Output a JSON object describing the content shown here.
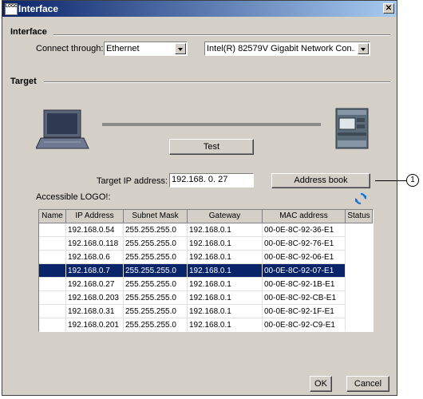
{
  "window": {
    "title": "Interface",
    "icon_text": "LOGO",
    "close_label": "✕"
  },
  "interface_section": {
    "label": "Interface",
    "connect_label": "Connect through:",
    "connect_value": "Ethernet",
    "adapter_value": "Intel(R) 82579V Gigabit Network Con..."
  },
  "target_section": {
    "label": "Target",
    "test_button": "Test",
    "target_ip_label": "Target IP address:",
    "target_ip_value": "192.168.  0. 27",
    "address_book_button": "Address book",
    "accessible_label": "Accessible LOGO!:"
  },
  "table": {
    "columns": [
      "Name",
      "IP Address",
      "Subnet Mask",
      "Gateway",
      "MAC address",
      "Status"
    ],
    "rows": [
      [
        "",
        "192.168.0.54",
        "255.255.255.0",
        "192.168.0.1",
        "00-0E-8C-92-36-E1",
        ""
      ],
      [
        "",
        "192.168.0.118",
        "255.255.255.0",
        "192.168.0.1",
        "00-0E-8C-92-76-E1",
        ""
      ],
      [
        "",
        "192.168.0.6",
        "255.255.255.0",
        "192.168.0.1",
        "00-0E-8C-92-06-E1",
        ""
      ],
      [
        "",
        "192.168.0.7",
        "255.255.255.0",
        "192.168.0.1",
        "00-0E-8C-92-07-E1",
        ""
      ],
      [
        "",
        "192.168.0.27",
        "255.255.255.0",
        "192.168.0.1",
        "00-0E-8C-92-1B-E1",
        ""
      ],
      [
        "",
        "192.168.0.203",
        "255.255.255.0",
        "192.168.0.1",
        "00-0E-8C-92-CB-E1",
        ""
      ],
      [
        "",
        "192.168.0.31",
        "255.255.255.0",
        "192.168.0.1",
        "00-0E-8C-92-1F-E1",
        ""
      ],
      [
        "",
        "192.168.0.201",
        "255.255.255.0",
        "192.168.0.1",
        "00-0E-8C-92-C9-E1",
        ""
      ]
    ],
    "selected_row": 3
  },
  "footer": {
    "ok_button": "OK",
    "cancel_button": "Cancel"
  },
  "callout": {
    "number": "1"
  },
  "icons": {
    "refresh": "refresh-icon",
    "computer": "laptop-icon",
    "device": "logo-module-icon"
  },
  "colors": {
    "titlebar": "#0a246a",
    "selection": "#0a246a",
    "window_bg": "#d4d0c8"
  }
}
